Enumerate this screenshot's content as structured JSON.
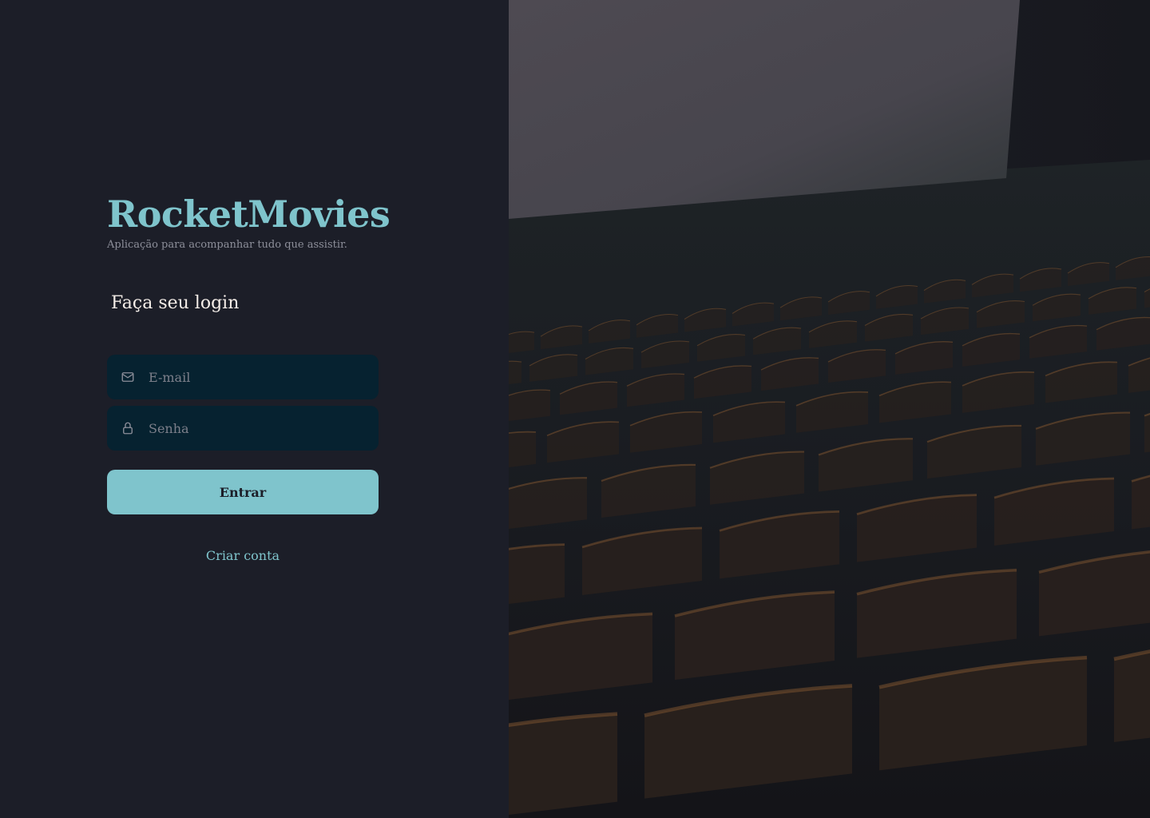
{
  "brand": {
    "title": "RocketMovies",
    "subtitle": "Aplicação para acompanhar tudo que assistir."
  },
  "form": {
    "heading": "Faça seu login",
    "email": {
      "placeholder": "E-mail",
      "value": "",
      "icon": "mail-icon"
    },
    "password": {
      "placeholder": "Senha",
      "value": "",
      "icon": "lock-icon"
    },
    "submit_label": "Entrar",
    "create_account_label": "Criar conta"
  },
  "colors": {
    "background": "#1c1e28",
    "accent": "#7fc4cc",
    "input_background": "#062230",
    "heading_text": "#f4ede8",
    "muted_text": "#8d8f9a"
  },
  "background_image": {
    "subject": "cinema-theater-seats-image"
  }
}
